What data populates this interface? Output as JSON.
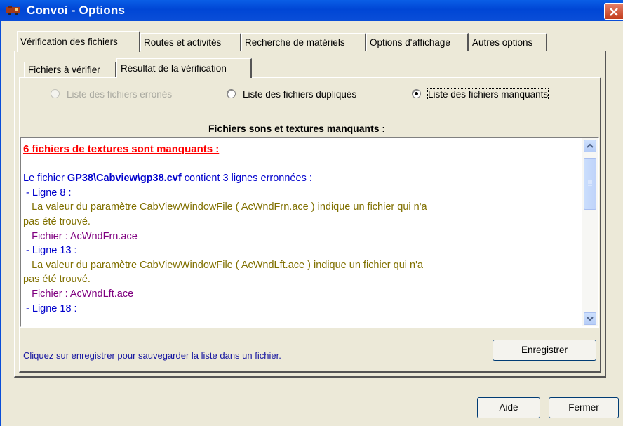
{
  "window": {
    "title": "Convoi - Options"
  },
  "tabs": [
    "Vérification des fichiers",
    "Routes et activités",
    "Recherche de matériels",
    "Options d'affichage",
    "Autres options"
  ],
  "subtabs": [
    "Fichiers à vérifier",
    "Résultat de la vérification"
  ],
  "radios": {
    "erroneous": "Liste des fichiers erronés",
    "duplicated": "Liste des fichiers dupliqués",
    "missing": "Liste des fichiers manquants"
  },
  "section_title": "Fichiers sons et textures manquants :",
  "list": {
    "header": "6 fichiers de textures sont manquants :",
    "file_prefix": "Le fichier ",
    "file_name": "GP38\\Cabview\\gp38.cvf",
    "file_suffix": " contient 3 lignes erronnées :",
    "line8": " - Ligne 8 :",
    "msg1a": "   La valeur du paramètre CabViewWindowFile ( AcWndFrn.ace ) indique un fichier qui n'a",
    "msg1b": "pas été trouvé.",
    "file1": "   Fichier : AcWndFrn.ace",
    "line13": " - Ligne 13 :",
    "msg2a": "   La valeur du paramètre CabViewWindowFile ( AcWndLft.ace ) indique un fichier qui n'a",
    "msg2b": "pas été trouvé.",
    "file2": "   Fichier : AcWndLft.ace",
    "line18": " - Ligne 18 :"
  },
  "hint": "Cliquez sur enregistrer pour sauvegarder la liste dans un fichier.",
  "buttons": {
    "save": "Enregistrer",
    "help": "Aide",
    "close": "Fermer"
  },
  "colors": {
    "titlebar": "#0046d5",
    "error_header": "#ff0000",
    "file_line": "#0000cc",
    "message": "#807000",
    "file": "#800080"
  }
}
